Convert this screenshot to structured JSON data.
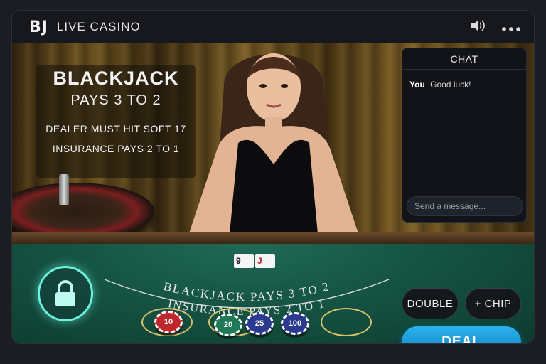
{
  "header": {
    "logo": "BJ",
    "title": "LIVE CASINO",
    "icons": [
      "speaker-icon",
      "more-icon"
    ]
  },
  "rules": {
    "title": "BLACKJACK",
    "pays": "PAYS 3 TO 2",
    "rule1": "DEALER MUST HIT SOFT 17",
    "rule2": "INSURANCE PAYS 2 TO 1"
  },
  "chat": {
    "title": "CHAT",
    "messages": [
      {
        "user": "You",
        "text": "Good luck!"
      }
    ],
    "placeholder": "Send a message..."
  },
  "table": {
    "arc_line1": "BLACKJACK PAYS 3 TO 2",
    "arc_line2": "INSURANCE PAYS 2 TO 1",
    "cards": [
      {
        "rank": "9",
        "color": "black"
      },
      {
        "rank": "J",
        "color": "red"
      }
    ],
    "chips": [
      {
        "value": "10",
        "color": "#c0272d"
      },
      {
        "value": "20",
        "color": "#1f7a55"
      },
      {
        "value": "25",
        "color": "#2b3a8f"
      },
      {
        "value": "100",
        "color": "#2b3a8f"
      }
    ]
  },
  "controls": {
    "double_label": "DOUBLE",
    "chip_label": "+ CHIP",
    "deal_label": "DEAL"
  },
  "colors": {
    "accent": "#2bb3ec",
    "lock_glow": "#6ef2e0",
    "felt": "#155343"
  }
}
